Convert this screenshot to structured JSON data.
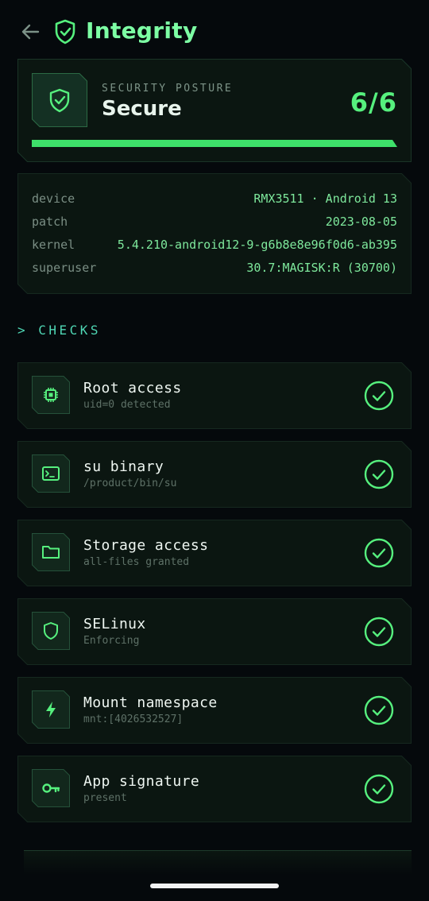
{
  "header": {
    "title": "Integrity",
    "back_icon": "arrow-left-icon",
    "title_icon": "shield-check-icon"
  },
  "posture": {
    "label": "SECURITY POSTURE",
    "status": "Secure",
    "score": "6/6",
    "progress_fraction": 1.0
  },
  "device_info": [
    {
      "key": "device",
      "value": "RMX3511 · Android 13"
    },
    {
      "key": "patch",
      "value": "2023-08-05"
    },
    {
      "key": "kernel",
      "value": "5.4.210-android12-9-g6b8e8e96f0d6-ab395"
    },
    {
      "key": "superuser",
      "value": "30.7:MAGISK:R (30700)"
    }
  ],
  "checks_heading": "> CHECKS",
  "checks": [
    {
      "name": "Root access",
      "detail": "uid=0 detected",
      "icon": "chip-icon",
      "status": "pass"
    },
    {
      "name": "su binary",
      "detail": "/product/bin/su",
      "icon": "terminal-icon",
      "status": "pass"
    },
    {
      "name": "Storage access",
      "detail": "all-files granted",
      "icon": "folder-icon",
      "status": "pass"
    },
    {
      "name": "SELinux",
      "detail": "Enforcing",
      "icon": "shield-icon",
      "status": "pass"
    },
    {
      "name": "Mount namespace",
      "detail": "mnt:[4026532527]",
      "icon": "bolt-icon",
      "status": "pass"
    },
    {
      "name": "App signature",
      "detail": "present",
      "icon": "key-icon",
      "status": "pass"
    }
  ],
  "colors": {
    "accent": "#7dffa4",
    "success": "#3ee06a",
    "background": "#05090c",
    "card": "#0b1611"
  }
}
